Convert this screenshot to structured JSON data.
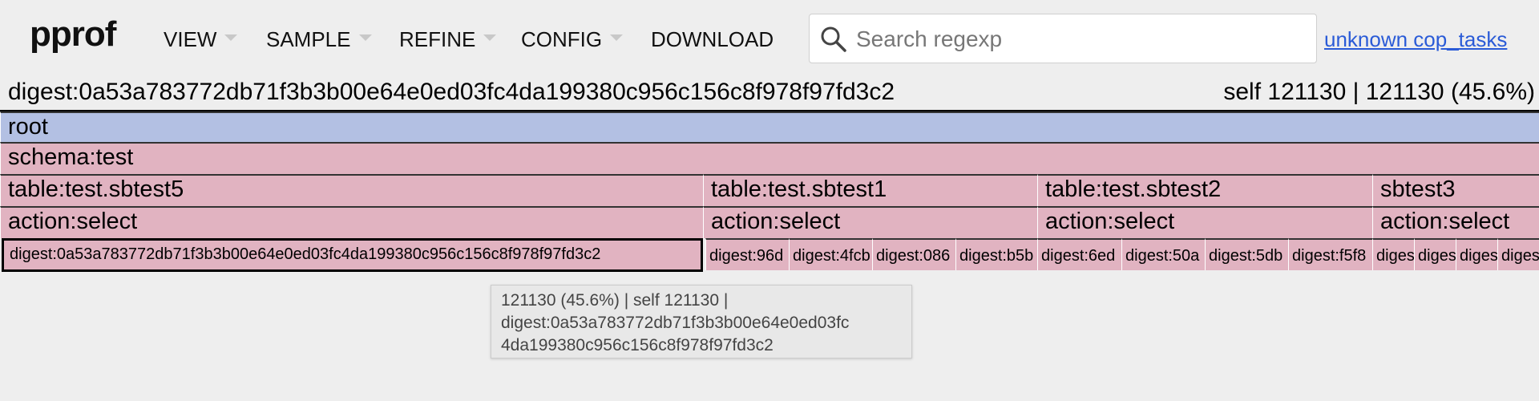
{
  "header": {
    "logo": "pprof",
    "menus": [
      {
        "label": "VIEW",
        "dropdown": true
      },
      {
        "label": "SAMPLE",
        "dropdown": true
      },
      {
        "label": "REFINE",
        "dropdown": true
      },
      {
        "label": "CONFIG",
        "dropdown": true
      },
      {
        "label": "DOWNLOAD",
        "dropdown": false
      }
    ],
    "search": {
      "placeholder": "Search regexp",
      "value": ""
    },
    "profile_link": "unknown cop_tasks"
  },
  "current": {
    "name": "digest:0a53a783772db71f3b3b00e64e0ed03fc4da199380c956c156c8f978f97fd3c2",
    "stats": "self 121130 | 121130 (45.6%)"
  },
  "flamegraph": {
    "colors": {
      "root": "#b3c0e3",
      "frame": "#e1b3c1",
      "selected_border": "#000000"
    },
    "rows": [
      [
        {
          "label": "root"
        }
      ],
      [
        {
          "label": "schema:test"
        }
      ],
      [
        {
          "label": "table:test.sbtest5"
        },
        {
          "label": "table:test.sbtest1"
        },
        {
          "label": "table:test.sbtest2"
        },
        {
          "label": "sbtest3"
        }
      ],
      [
        {
          "label": "action:select"
        },
        {
          "label": "action:select"
        },
        {
          "label": "action:select"
        },
        {
          "label": "action:select"
        }
      ],
      [
        {
          "label": "digest:0a53a783772db71f3b3b00e64e0ed03fc4da199380c956c156c8f978f97fd3c2"
        },
        {
          "label": "digest:96d"
        },
        {
          "label": "digest:4fcb"
        },
        {
          "label": "digest:086"
        },
        {
          "label": "digest:b5b"
        },
        {
          "label": "digest:6ed"
        },
        {
          "label": "digest:50a"
        },
        {
          "label": "digest:5db"
        },
        {
          "label": "digest:f5f8"
        },
        {
          "label": "digest"
        },
        {
          "label": "digest"
        },
        {
          "label": "digest"
        },
        {
          "label": "digest"
        }
      ]
    ]
  },
  "tooltip": {
    "lines": [
      "121130 (45.6%) | self 121130 |",
      "digest:0a53a783772db71f3b3b00e64e0ed03fc",
      "4da199380c956c156c8f978f97fd3c2"
    ]
  }
}
